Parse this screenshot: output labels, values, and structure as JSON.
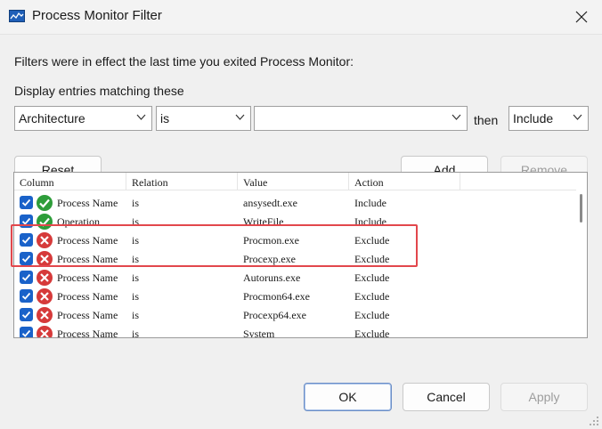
{
  "window": {
    "title": "Process Monitor Filter",
    "app_icon": "monitor-graph-icon",
    "close_icon": "close-icon"
  },
  "intro_text": "Filters were in effect the last time you exited Process Monitor:",
  "match_label": "Display entries matching these",
  "filter_row": {
    "column_select": "Architecture",
    "relation_select": "is",
    "value_input": "",
    "then_label": "then",
    "action_select": "Include"
  },
  "buttons": {
    "reset": "Reset",
    "add": "Add",
    "remove": "Remove",
    "ok": "OK",
    "cancel": "Cancel",
    "apply": "Apply"
  },
  "list": {
    "headers": [
      "Column",
      "Relation",
      "Value",
      "Action"
    ],
    "rows": [
      {
        "column": "Process Name",
        "relation": "is",
        "value": "ansysedt.exe",
        "action": "Include",
        "checked": true,
        "icon": "include-check-icon"
      },
      {
        "column": "Operation",
        "relation": "is",
        "value": "WriteFile",
        "action": "Include",
        "checked": true,
        "icon": "include-check-icon"
      },
      {
        "column": "Process Name",
        "relation": "is",
        "value": "Procmon.exe",
        "action": "Exclude",
        "checked": true,
        "icon": "exclude-x-icon"
      },
      {
        "column": "Process Name",
        "relation": "is",
        "value": "Procexp.exe",
        "action": "Exclude",
        "checked": true,
        "icon": "exclude-x-icon"
      },
      {
        "column": "Process Name",
        "relation": "is",
        "value": "Autoruns.exe",
        "action": "Exclude",
        "checked": true,
        "icon": "exclude-x-icon"
      },
      {
        "column": "Process Name",
        "relation": "is",
        "value": "Procmon64.exe",
        "action": "Exclude",
        "checked": true,
        "icon": "exclude-x-icon"
      },
      {
        "column": "Process Name",
        "relation": "is",
        "value": "Procexp64.exe",
        "action": "Exclude",
        "checked": true,
        "icon": "exclude-x-icon"
      },
      {
        "column": "Process Name",
        "relation": "is",
        "value": "System",
        "action": "Exclude",
        "checked": true,
        "icon": "exclude-x-icon"
      }
    ]
  },
  "colors": {
    "highlight": "#e2474c",
    "include": "#2e9d3a",
    "exclude": "#d63a3a",
    "checkbox": "#1a62c9"
  }
}
